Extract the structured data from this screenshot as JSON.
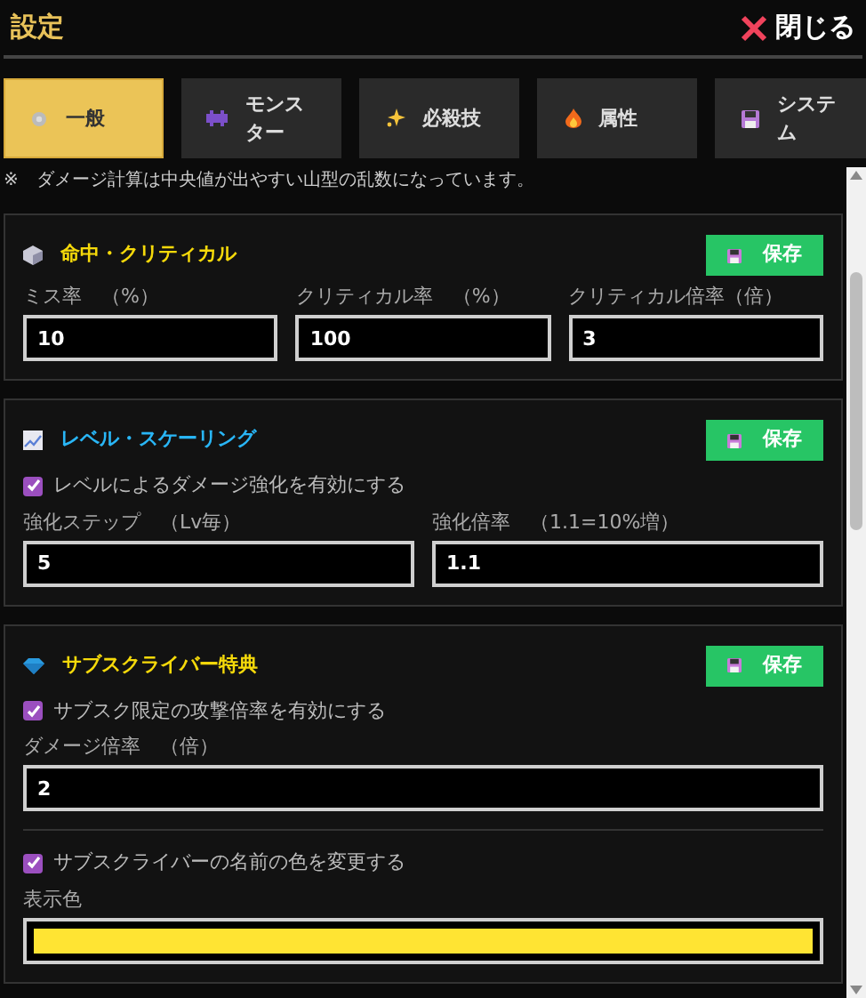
{
  "header": {
    "title": "設定",
    "close_label": "閉じる"
  },
  "tabs": [
    {
      "label": "一般",
      "selected": true
    },
    {
      "label": "モンスター",
      "selected": false
    },
    {
      "label": "必殺技",
      "selected": false
    },
    {
      "label": "属性",
      "selected": false
    },
    {
      "label": "システム",
      "selected": false
    }
  ],
  "note": "※　ダメージ計算は中央値が出やすい山型の乱数になっています。",
  "sections": [
    {
      "title": "命中・クリティカル",
      "color": "#f5d90a",
      "save_label": "保存",
      "items": [
        {
          "kind": "fields",
          "fields": [
            {
              "label": "ミス率　（%）",
              "value": "10"
            },
            {
              "label": "クリティカル率　（%）",
              "value": "100"
            },
            {
              "label": "クリティカル倍率（倍）",
              "value": "3"
            }
          ]
        }
      ]
    },
    {
      "title": "レベル・スケーリング",
      "color": "#29b6f6",
      "save_label": "保存",
      "items": [
        {
          "kind": "checkbox",
          "label": "レベルによるダメージ強化を有効にする",
          "checked": true
        },
        {
          "kind": "fields",
          "fields": [
            {
              "label": "強化ステップ　（Lv毎）",
              "value": "5"
            },
            {
              "label": "強化倍率　（1.1=10%増）",
              "value": "1.1"
            }
          ]
        }
      ]
    },
    {
      "title": "サブスクライバー特典",
      "color": "#f5d90a",
      "save_label": "保存",
      "items": [
        {
          "kind": "checkbox",
          "label": "サブスク限定の攻撃倍率を有効にする",
          "checked": true
        },
        {
          "kind": "fields",
          "fields": [
            {
              "label": "ダメージ倍率　（倍）",
              "value": "2"
            }
          ]
        },
        {
          "kind": "divider"
        },
        {
          "kind": "checkbox",
          "label": "サブスクライバーの名前の色を変更する",
          "checked": true
        },
        {
          "kind": "color",
          "label": "表示色",
          "color": "#ffe433"
        }
      ]
    }
  ]
}
